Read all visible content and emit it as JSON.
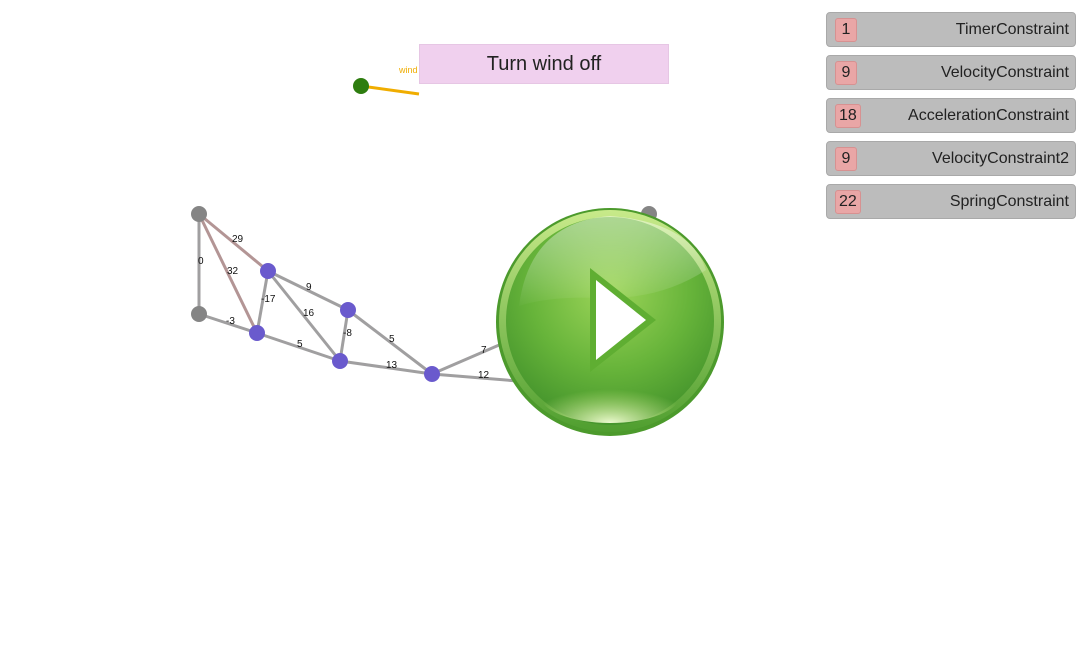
{
  "wind": {
    "button_label": "Turn wind off",
    "indicator_label": "wind",
    "indicator_color": "#f0ad00",
    "anchor_color": "#2e7d0f"
  },
  "constraints": [
    {
      "count": "1",
      "name": "TimerConstraint"
    },
    {
      "count": "9",
      "name": "VelocityConstraint"
    },
    {
      "count": "18",
      "name": "AccelerationConstraint"
    },
    {
      "count": "9",
      "name": "VelocityConstraint2"
    },
    {
      "count": "22",
      "name": "SpringConstraint"
    }
  ],
  "graph": {
    "fixed_node_color": "#858585",
    "free_node_color": "#6a5acd",
    "edge_color": "#a09fa0",
    "stressed_edge_color": "#b39595",
    "edge_labels": {
      "e1": "29",
      "e2": "0",
      "e3": "32",
      "e4": "-17",
      "e5": "-3",
      "e6": "9",
      "e7": "16",
      "e8": "5",
      "e9": "-8",
      "e10": "5",
      "e11": "13",
      "e12": "7",
      "e13": "12"
    }
  },
  "play_button": {
    "icon": "play-icon",
    "color": "#6cbf3b"
  }
}
